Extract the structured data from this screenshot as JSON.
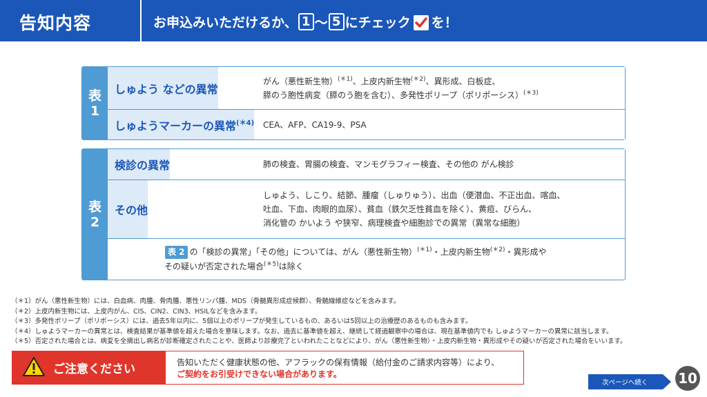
{
  "header": {
    "title": "告知内容",
    "msg_prefix": "お申込みいただけるか、",
    "num_start": "1",
    "tilde": "〜",
    "num_end": "5",
    "msg_middle": "にチェック",
    "msg_suffix": "を！"
  },
  "table1": {
    "label": "表\n1",
    "rows": [
      {
        "category": "しゅよう などの異常",
        "category_sup": "",
        "lines": [
          {
            "parts": [
              "がん（悪性新生物）",
              "(＊1)",
              "、上皮内新生物",
              "(＊2)",
              "、異形成、白板症、"
            ]
          },
          {
            "parts": [
              "膵のう胞性病変（膵のう胞を含む）、多発性ポリープ（ポリポーシス）",
              "(＊3)"
            ]
          }
        ]
      },
      {
        "category": "しゅようマーカーの異常",
        "category_sup": "(＊4)",
        "lines": [
          {
            "parts": [
              "CEA、AFP、CA19-9、PSA"
            ]
          }
        ]
      }
    ]
  },
  "table2": {
    "label": "表\n2",
    "rows": [
      {
        "category": "検診の異常",
        "lines": [
          {
            "parts": [
              "肺の検査、胃腸の検査、マンモグラフィー検査、その他の がん検診"
            ]
          }
        ]
      },
      {
        "category": "その他",
        "lines": [
          {
            "parts": [
              "しゅよう、しこり、結節、腫瘤（しゅりゅう）、出血（便潜血、不正出血、喀血、"
            ]
          },
          {
            "parts": [
              "吐血、下血、肉眼的血尿）、貧血（鉄欠乏性貧血を除く）、黄疸、びらん、"
            ]
          },
          {
            "parts": [
              "消化管の かいよう や狭窄、病理検査や細胞診での異常（異常な細胞）"
            ]
          }
        ]
      }
    ],
    "note": {
      "badge": "表 2",
      "line1_a": "の「検診の異常」「その他」については、がん（悪性新生物）",
      "line1_sup1": "(＊1)",
      "line1_b": "・上皮内新生物",
      "line1_sup2": "(＊2)",
      "line1_c": "・異形成や",
      "line2_a": "その疑いが否定された場合",
      "line2_sup": "(＊5)",
      "line2_b": "は除く"
    }
  },
  "footnotes": [
    "（＊1）がん（悪性新生物）には、白血病、肉腫、骨肉腫、悪性リンパ腫、MDS（骨髄異形成症候群）、骨髄線維症などを含みます。",
    "（＊2）上皮内新生物には、上皮内がん、CIS、CIN2、CIN3、HSILなどを含みます。",
    "（＊3）多発性ポリープ（ポリポーシス）には、過去5年以内に、5個以上のポリープが発生しているもの、あるいは5回以上の治療歴のあるものも含みます。",
    "（＊4）しゅようマーカーの異常とは、検査結果が基準値を超えた場合を意味します。なお、過去に基準値を超え、継続して経過観察中の場合は、現在基準値内でも しゅようマーカーの異常に該当します。",
    "（＊5）否定された場合とは、病変を全摘出し病名が診断確定されたことや、医師より診療完了といわれたことなどにより、がん（悪性新生物）・上皮内新生物・異形成やその疑いが否定された場合をいいます。"
  ],
  "caution": {
    "title": "ご注意ください",
    "line1": "告知いただく健康状態の他、アフラックの保有情報（給付金のご請求内容等）により、",
    "line2": "ご契約をお引受けできない場合があります。"
  },
  "next_label": "次ページへ続く",
  "page_number": "10",
  "colors": {
    "primary": "#1b57b8",
    "accent": "#4f9bd4",
    "light": "#ddeaf7",
    "warning": "#e0352b"
  },
  "icons": {
    "check": "check-icon",
    "warning": "warning-icon"
  }
}
